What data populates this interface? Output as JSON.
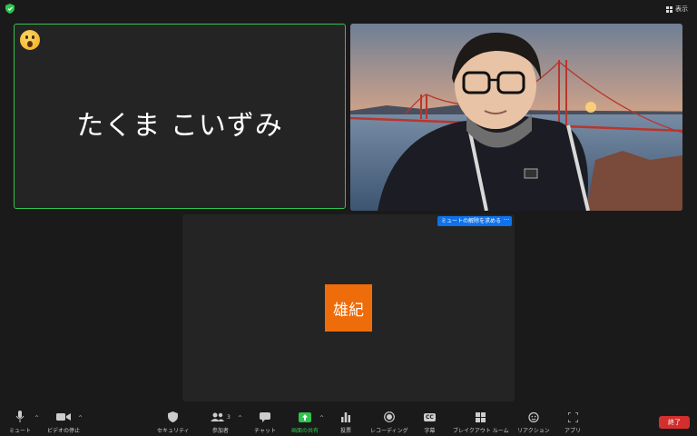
{
  "top": {
    "view_label": "表示"
  },
  "tiles": {
    "participant_1": {
      "name": "たくま こいずみ"
    },
    "participant_3": {
      "avatar_text": "雄紀",
      "request_unmute": "ミュートの解除を求める",
      "more": "···"
    }
  },
  "toolbar": {
    "mute": "ミュート",
    "stop_video": "ビデオの停止",
    "security": "セキュリティ",
    "participants": "参加者",
    "participants_count": "3",
    "chat": "チャット",
    "share_screen": "画面の共有",
    "polls": "投票",
    "recording": "レコーディング",
    "captions": "字幕",
    "captions_icon": "CC",
    "breakout": "ブレイクアウト ルーム",
    "reactions": "リアクション",
    "apps": "アプリ",
    "end": "終了"
  },
  "colors": {
    "active_speaker": "#2ec44f",
    "avatar_bg": "#ef6c0a",
    "end_button": "#d32f2f",
    "accent_blue": "#0e72ed"
  },
  "icons": [
    "shield-icon",
    "grid-view-icon",
    "surprised-emoji-icon",
    "microphone-icon",
    "video-camera-icon",
    "security-shield-icon",
    "participants-icon",
    "chat-bubble-icon",
    "share-screen-icon",
    "polls-icon",
    "record-icon",
    "captions-icon",
    "breakout-rooms-icon",
    "reactions-icon",
    "apps-icon"
  ]
}
